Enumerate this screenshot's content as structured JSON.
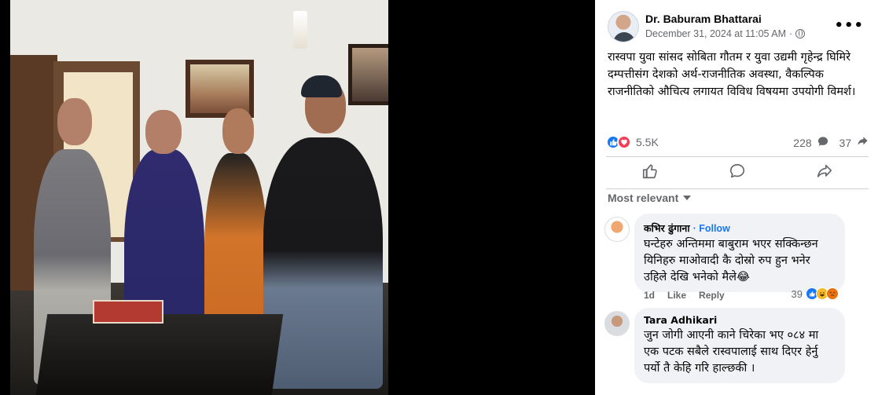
{
  "post": {
    "author": "Dr. Baburam Bhattarai",
    "date": "December 31, 2024 at 11:05 AM",
    "more_label": "•••",
    "text": "रास्वपा युवा सांसद सोबिता गौतम र युवा उद्यमी गृहेन्द्र घिमिरे दम्पत्तीसंग देशको अर्थ-राजनीतिक अवस्था, वैकल्पिक राजनीतिको औचित्य लगायत विविध विषयमा उपयोगी विमर्श।",
    "reaction_count": "5.5K",
    "comment_count": "228",
    "share_count": "37"
  },
  "sort_label": "Most relevant",
  "comments": [
    {
      "name": "कभिर ढुंगाना",
      "follow": "· Follow",
      "text": "घन्टेहरु अन्तिममा बाबुराम भएर सक्किन्छन यिनिहरु माओवादी कै दोस्रो रुप हुन भनेर उहिले देखि भनेको मैले😂",
      "time": "1d",
      "like": "Like",
      "reply": "Reply",
      "reactions": "39"
    },
    {
      "name": "Tara Adhikari",
      "text": "जुन जोगी आएनी काने चिरेका भए ०८४ मा एक पटक सबैले रास्वपालाई साथ दिएर हेर्नु पर्यो तै केहि गरि हाल्छकी ।"
    }
  ],
  "colors": {
    "like_blue": "#1877f2",
    "love_red": "#f33e58",
    "secondary_text": "#65676b",
    "bubble_bg": "#f0f2f5"
  }
}
